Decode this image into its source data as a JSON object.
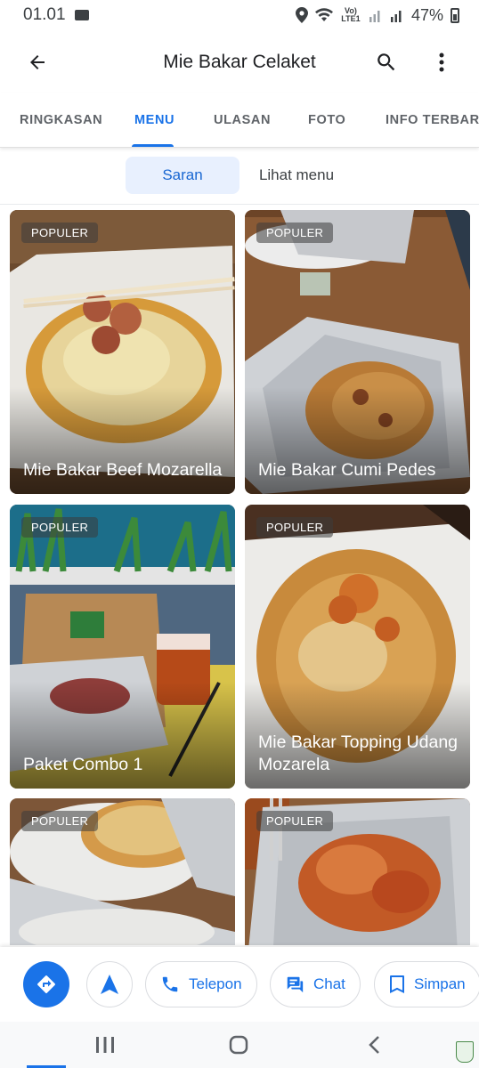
{
  "status_bar": {
    "time": "01.01",
    "network": "Vo) LTE1",
    "battery": "47%",
    "icons": [
      "mail-icon",
      "location-icon",
      "wifi-icon",
      "signal-icon",
      "battery-icon"
    ]
  },
  "app_bar": {
    "title": "Mie Bakar Celaket",
    "icons": [
      "back-arrow-icon",
      "search-icon",
      "more-vertical-icon"
    ]
  },
  "tabs": [
    {
      "label": "RINGKASAN",
      "active": false
    },
    {
      "label": "MENU",
      "active": true
    },
    {
      "label": "ULASAN",
      "active": false
    },
    {
      "label": "FOTO",
      "active": false
    },
    {
      "label": "INFO TERBARU",
      "active": false
    }
  ],
  "segments": {
    "saran": "Saran",
    "lihat_menu": "Lihat menu",
    "active": "Saran"
  },
  "menu_items": [
    {
      "badge": "POPULER",
      "name": "Mie Bakar Beef Mozarella"
    },
    {
      "badge": "POPULER",
      "name": "Mie Bakar Cumi Pedes"
    },
    {
      "badge": "POPULER",
      "name": "Paket Combo 1"
    },
    {
      "badge": "POPULER",
      "name": "Mie Bakar Topping Udang Mozarela"
    },
    {
      "badge": "POPULER",
      "name": ""
    },
    {
      "badge": "POPULER",
      "name": ""
    }
  ],
  "actions": {
    "telepon": "Telepon",
    "chat": "Chat",
    "simpan": "Simpan",
    "icons": [
      "directions-icon",
      "navigate-icon",
      "phone-icon",
      "chat-icon",
      "bookmark-icon"
    ]
  },
  "colors": {
    "accent": "#1a73e8",
    "segment_bg": "#e8f0fe",
    "text": "#202124",
    "muted": "#5f6368"
  }
}
